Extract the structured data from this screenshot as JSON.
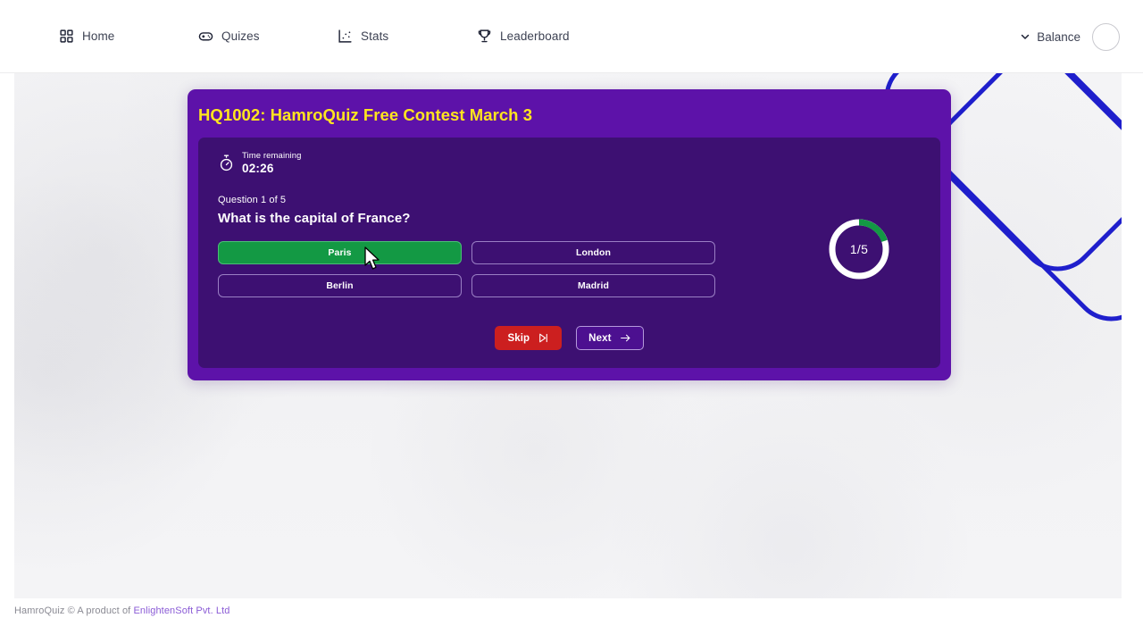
{
  "header": {
    "nav": [
      {
        "label": "Home",
        "icon": "grid-icon"
      },
      {
        "label": "Quizes",
        "icon": "gamepad-icon"
      },
      {
        "label": "Stats",
        "icon": "stats-icon"
      },
      {
        "label": "Leaderboard",
        "icon": "trophy-icon"
      }
    ],
    "balance_label": "Balance",
    "chevron_icon": "chevron-down-icon",
    "avatar_icon": "avatar-icon"
  },
  "quiz": {
    "title": "HQ1002: HamroQuiz Free Contest March 3",
    "timer": {
      "icon": "stopwatch-icon",
      "caption": "Time remaining",
      "value": "02:26"
    },
    "question": {
      "counter": "Question 1 of 5",
      "text": "What is the capital of France?"
    },
    "options": [
      {
        "label": "Paris",
        "selected": true
      },
      {
        "label": "London",
        "selected": false
      },
      {
        "label": "Berlin",
        "selected": false
      },
      {
        "label": "Madrid",
        "selected": false
      }
    ],
    "progress": {
      "label": "1/5",
      "current": 1,
      "total": 5,
      "track_color": "#ffffff",
      "fill_color": "#139944"
    },
    "actions": {
      "skip_label": "Skip",
      "skip_icon": "skip-forward-icon",
      "next_label": "Next",
      "next_icon": "arrow-right-icon"
    }
  },
  "footer": {
    "text": "HamroQuiz © A product of ",
    "link": "EnlightenSoft Pvt. Ltd"
  },
  "colors": {
    "card_purple": "#5d12a9",
    "panel_purple": "#3d1072",
    "title_yellow": "#ffe51f",
    "correct_green": "#139944",
    "skip_red": "#cc1f1f",
    "deco_blue": "#1f1fcc",
    "link_purple": "#8b5cd6"
  }
}
